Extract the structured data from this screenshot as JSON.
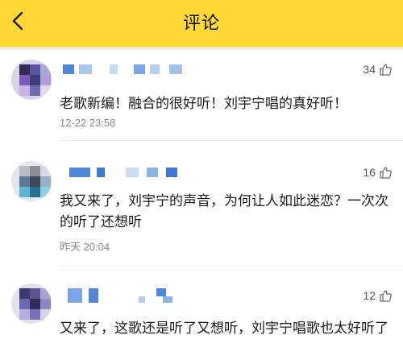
{
  "header": {
    "title": "评论",
    "back_icon": "chevron-left-icon",
    "background": "#fed834"
  },
  "comments": [
    {
      "text": "老歌新编！融合的很好听！刘宇宁唱的真好听！",
      "time": "12-22 23:58",
      "likes": "34"
    },
    {
      "text": "我又来了，刘宇宁的声音，为何让人如此迷恋？一次次的听了还想听",
      "time": "昨天 20:04",
      "likes": "16"
    },
    {
      "text": "又来了，这歌还是听了又想听，刘宇宁唱歌也太好听了",
      "time": "",
      "likes": "12"
    }
  ]
}
